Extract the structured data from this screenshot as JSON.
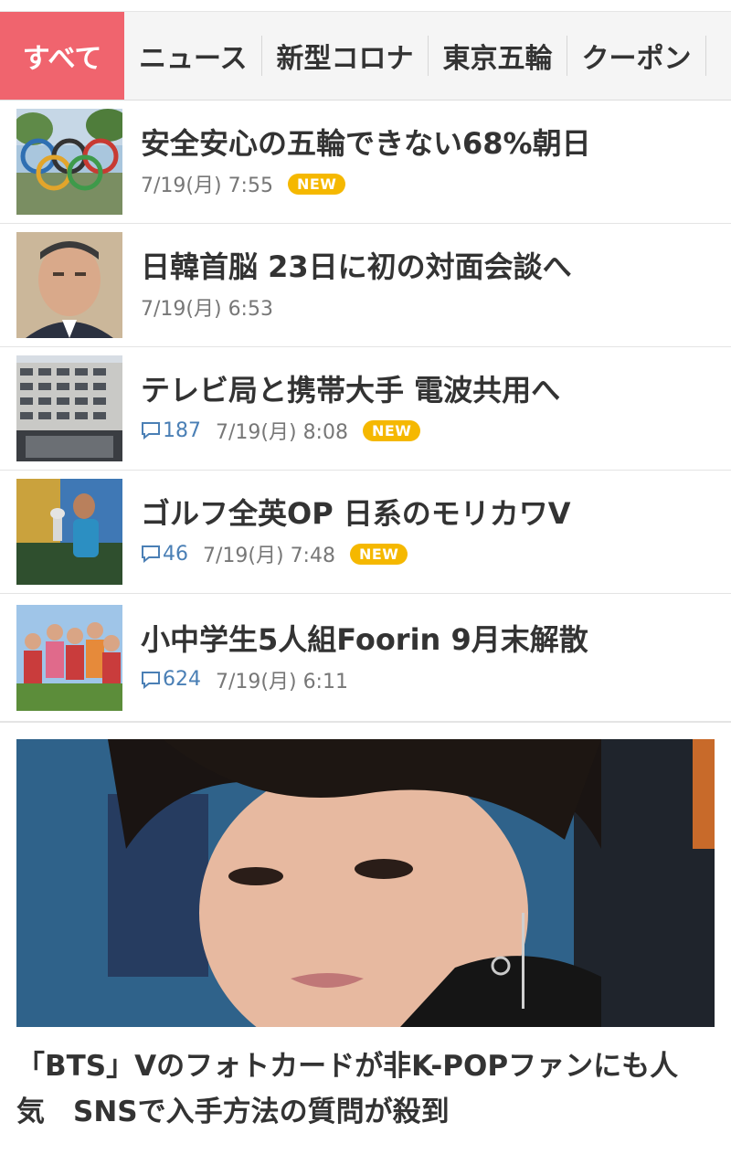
{
  "tabs": [
    {
      "label": "すべて",
      "active": true
    },
    {
      "label": "ニュース",
      "active": false
    },
    {
      "label": "新型コロナ",
      "active": false
    },
    {
      "label": "東京五輪",
      "active": false
    },
    {
      "label": "クーポン",
      "active": false
    }
  ],
  "articles": [
    {
      "title": "安全安心の五輪できない68%朝日",
      "comments": "",
      "date": "7/19(月) 7:55",
      "badge": "NEW",
      "thumb": "olympic-rings-photo"
    },
    {
      "title": "日韓首脳 23日に初の対面会談へ",
      "comments": "",
      "date": "7/19(月) 6:53",
      "badge": "",
      "thumb": "politician-portrait-photo"
    },
    {
      "title": "テレビ局と携帯大手 電波共用へ",
      "comments": "187",
      "date": "7/19(月) 8:08",
      "badge": "NEW",
      "thumb": "office-building-photo"
    },
    {
      "title": "ゴルフ全英OP 日系のモリカワV",
      "comments": "46",
      "date": "7/19(月) 7:48",
      "badge": "NEW",
      "thumb": "golfer-trophy-photo"
    },
    {
      "title": "小中学生5人組Foorin 9月末解散",
      "comments": "624",
      "date": "7/19(月) 6:11",
      "badge": "",
      "thumb": "music-group-photo"
    }
  ],
  "feature": {
    "title": "「BTS」Vのフォトカードが非K-POPファンにも人気　SNSで入手方法の質問が殺到",
    "image": "portrait-photo"
  },
  "colors": {
    "accent": "#f0646e",
    "badge": "#f5b800",
    "link": "#4a7fb5"
  }
}
